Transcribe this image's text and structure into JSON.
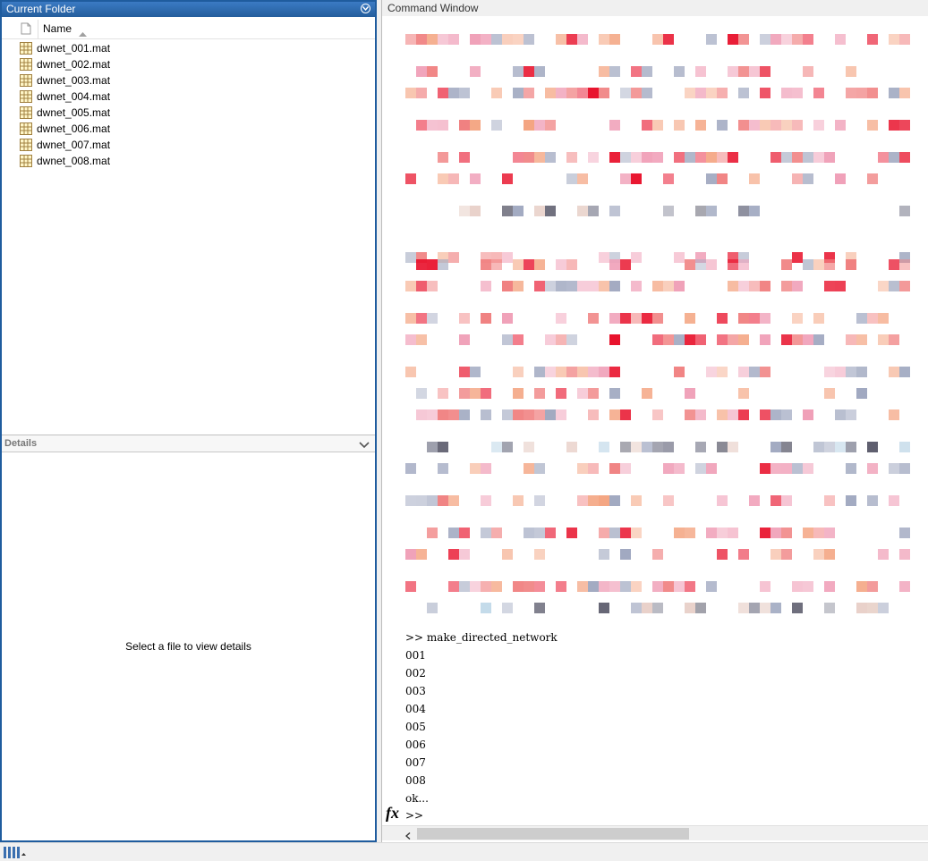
{
  "current_folder": {
    "title": "Current Folder",
    "column_name": "Name",
    "files": [
      "dwnet_001.mat",
      "dwnet_002.mat",
      "dwnet_003.mat",
      "dwnet_004.mat",
      "dwnet_005.mat",
      "dwnet_006.mat",
      "dwnet_007.mat",
      "dwnet_008.mat"
    ]
  },
  "details": {
    "title": "Details",
    "empty_message": "Select a file to view details"
  },
  "command_window": {
    "title": "Command Window",
    "command": ">> make_directed_network",
    "outputs": [
      "001",
      "002",
      "003",
      "004",
      "005",
      "006",
      "007",
      "008",
      "ok..."
    ],
    "prompt": ">>"
  },
  "icons": {
    "menu": "circle-chevron-down-icon",
    "sort": "sort-ascending-icon",
    "file": "mat-file-icon",
    "details_toggle": "chevron-down-icon",
    "fx": "function-browser-icon",
    "scroll_left": "scroll-left-arrow-icon",
    "layout": "layout-icon"
  },
  "colors": {
    "panel_accent": "#2b6cb0",
    "pixel_palette": [
      "#f08080",
      "#f4a582",
      "#f0a0b8",
      "#e8102a",
      "#a0a8c0",
      "#f7d8a8",
      "#888888"
    ]
  }
}
